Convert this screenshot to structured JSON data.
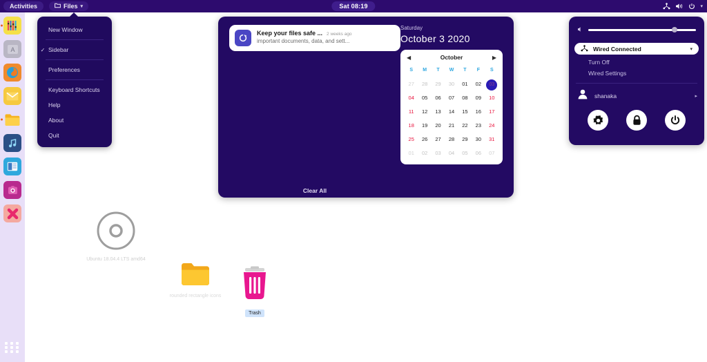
{
  "topbar": {
    "activities": "Activities",
    "app_name": "Files",
    "app_caret": "▾",
    "clock": "Sat 08:19",
    "icons": [
      "network-icon",
      "volume-icon",
      "power-icon",
      "chevron-down-icon"
    ]
  },
  "dock": {
    "items": [
      {
        "name": "equalizer-app",
        "running": true
      },
      {
        "name": "text-editor-app",
        "running": false
      },
      {
        "name": "firefox-app",
        "running": false
      },
      {
        "name": "mail-app",
        "running": false
      },
      {
        "name": "files-app",
        "running": true
      },
      {
        "name": "music-app",
        "running": false
      },
      {
        "name": "office-app",
        "running": false
      },
      {
        "name": "photos-app",
        "running": false
      },
      {
        "name": "close-x-app",
        "running": false
      }
    ],
    "show_apps": "show-applications-grid"
  },
  "files_menu": {
    "items": [
      {
        "label": "New Window",
        "checked": false
      },
      {
        "label": "Sidebar",
        "checked": true
      },
      {
        "label": "Preferences",
        "checked": false
      },
      {
        "label": "Keyboard Shortcuts",
        "checked": false
      },
      {
        "label": "Help",
        "checked": false
      },
      {
        "label": "About",
        "checked": false
      },
      {
        "label": "Quit",
        "checked": false
      }
    ],
    "check_glyph": "✓"
  },
  "notifications": {
    "title": "Keep your files safe ...",
    "time": "2 weeks ago",
    "subtitle": "important documents, data, and sett...",
    "icon": "sync-icon",
    "clear_all": "Clear All"
  },
  "calendar": {
    "weekday": "Saturday",
    "date_long": "October  3 2020",
    "month": "October",
    "prev": "◀",
    "next": "▶",
    "dow": [
      "S",
      "M",
      "T",
      "W",
      "T",
      "F",
      "S"
    ],
    "weeks": [
      [
        {
          "d": "27",
          "dim": true,
          "wk": true
        },
        {
          "d": "28",
          "dim": true,
          "wk": false
        },
        {
          "d": "29",
          "dim": true,
          "wk": false
        },
        {
          "d": "30",
          "dim": true,
          "wk": false
        },
        {
          "d": "01",
          "dim": false,
          "wk": false
        },
        {
          "d": "02",
          "dim": false,
          "wk": false
        },
        {
          "d": "03",
          "dim": false,
          "wk": true,
          "sel": true
        }
      ],
      [
        {
          "d": "04",
          "dim": false,
          "wk": true
        },
        {
          "d": "05",
          "dim": false,
          "wk": false
        },
        {
          "d": "06",
          "dim": false,
          "wk": false
        },
        {
          "d": "07",
          "dim": false,
          "wk": false
        },
        {
          "d": "08",
          "dim": false,
          "wk": false
        },
        {
          "d": "09",
          "dim": false,
          "wk": false
        },
        {
          "d": "10",
          "dim": false,
          "wk": true
        }
      ],
      [
        {
          "d": "11",
          "dim": false,
          "wk": true
        },
        {
          "d": "12",
          "dim": false,
          "wk": false
        },
        {
          "d": "13",
          "dim": false,
          "wk": false
        },
        {
          "d": "14",
          "dim": false,
          "wk": false
        },
        {
          "d": "15",
          "dim": false,
          "wk": false
        },
        {
          "d": "16",
          "dim": false,
          "wk": false
        },
        {
          "d": "17",
          "dim": false,
          "wk": true
        }
      ],
      [
        {
          "d": "18",
          "dim": false,
          "wk": true
        },
        {
          "d": "19",
          "dim": false,
          "wk": false
        },
        {
          "d": "20",
          "dim": false,
          "wk": false
        },
        {
          "d": "21",
          "dim": false,
          "wk": false
        },
        {
          "d": "22",
          "dim": false,
          "wk": false
        },
        {
          "d": "23",
          "dim": false,
          "wk": false
        },
        {
          "d": "24",
          "dim": false,
          "wk": true
        }
      ],
      [
        {
          "d": "25",
          "dim": false,
          "wk": true
        },
        {
          "d": "26",
          "dim": false,
          "wk": false
        },
        {
          "d": "27",
          "dim": false,
          "wk": false
        },
        {
          "d": "28",
          "dim": false,
          "wk": false
        },
        {
          "d": "29",
          "dim": false,
          "wk": false
        },
        {
          "d": "30",
          "dim": false,
          "wk": false
        },
        {
          "d": "31",
          "dim": false,
          "wk": true
        }
      ],
      [
        {
          "d": "01",
          "dim": true,
          "wk": true
        },
        {
          "d": "02",
          "dim": true,
          "wk": false
        },
        {
          "d": "03",
          "dim": true,
          "wk": false
        },
        {
          "d": "04",
          "dim": true,
          "wk": false
        },
        {
          "d": "05",
          "dim": true,
          "wk": false
        },
        {
          "d": "06",
          "dim": true,
          "wk": false
        },
        {
          "d": "07",
          "dim": true,
          "wk": true
        }
      ]
    ]
  },
  "sysmenu": {
    "volume_percent": 80,
    "volume_icon": "volume-icon",
    "network_label": "Wired Connected",
    "network_icon": "network-icon",
    "network_caret": "▾",
    "network_options": [
      "Turn Off",
      "Wired Settings"
    ],
    "user_name": "shanaka",
    "user_caret": "▸",
    "actions": [
      "settings-gear-button",
      "lock-button",
      "power-button"
    ]
  },
  "desktop_icons": [
    {
      "name": "cd-drive",
      "label": "Ubuntu 18.04.4 LTS amd64",
      "style": "faint"
    },
    {
      "name": "folder-rounded-rectangle-icons",
      "label": "rounded rectangle icons",
      "style": "folder"
    },
    {
      "name": "trash",
      "label": "Trash",
      "style": "sel"
    }
  ],
  "colors": {
    "topbar_bg": "#2d0b6e",
    "panel_bg": "#230a63",
    "menu_bg": "#200a5e",
    "dock_bg": "#e8dff8",
    "accent_selected": "#2a1bb5",
    "weekend_red": "#e8133c",
    "dow_blue": "#2fa7e0",
    "folder_orange": "#f7a81b",
    "trash_pink": "#e8178f"
  }
}
